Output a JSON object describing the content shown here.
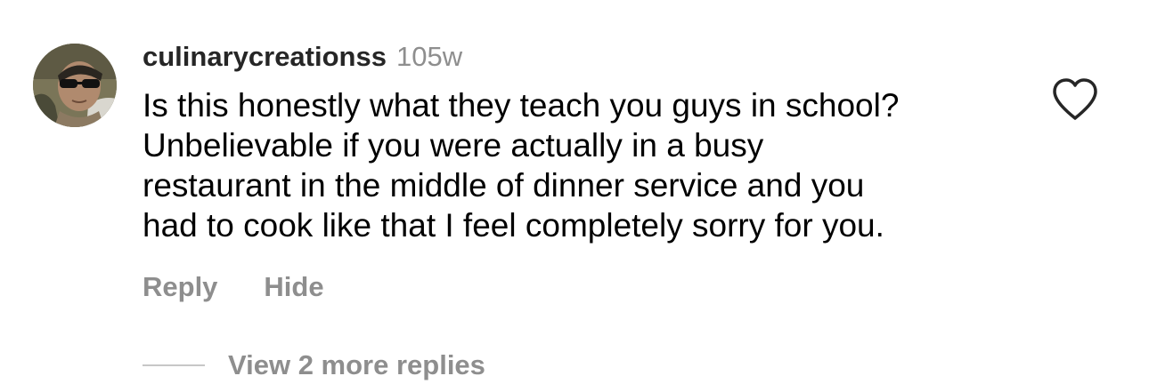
{
  "comment": {
    "username": "culinarycreationss",
    "timestamp": "105w",
    "text": "Is this honestly what they teach you guys in school?\nUnbelievable if you were actually in a busy\nrestaurant in the middle of dinner service and you\nhad to cook like that I feel completely sorry for you.",
    "like_icon": "heart-outline-icon",
    "actions": {
      "reply_label": "Reply",
      "hide_label": "Hide"
    },
    "view_replies_label": "View 2 more replies"
  },
  "colors": {
    "username": "#262626",
    "secondary_text": "#8e8e8e",
    "body_text": "#000000",
    "divider": "#c7c7c7",
    "icon_stroke": "#262626"
  }
}
